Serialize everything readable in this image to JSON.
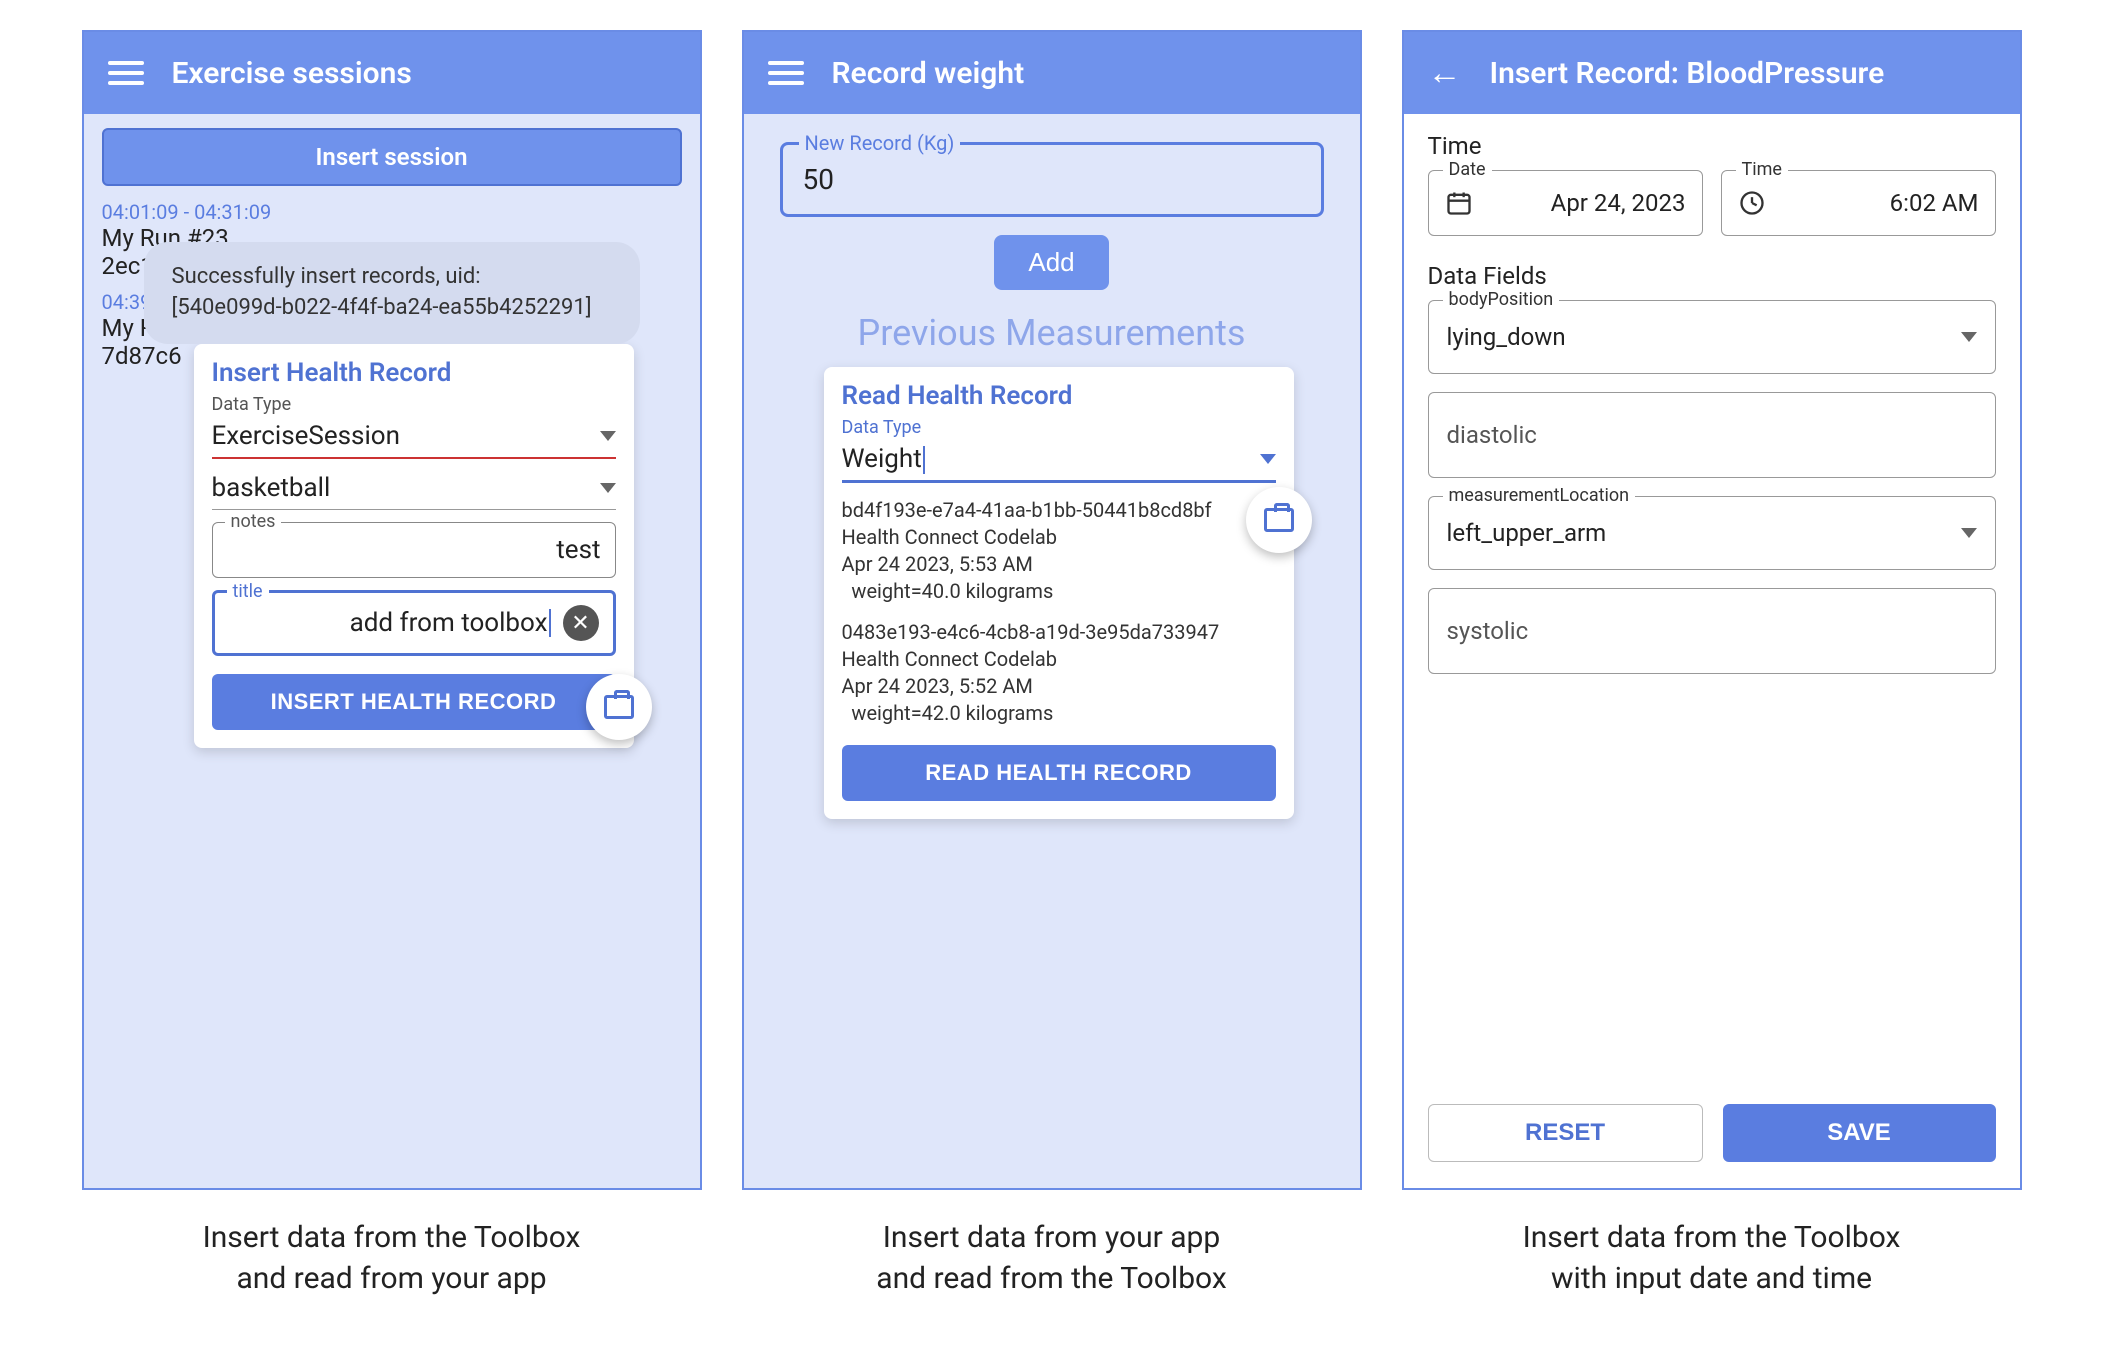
{
  "panel1": {
    "appbar_title": "Exercise sessions",
    "insert_session_btn": "Insert session",
    "runs": [
      {
        "time": "04:01:09 - 04:31:09",
        "title": "My Run #23",
        "uuid": "2ec1eaa2-97f5-4597-b908-18221abf019c"
      },
      {
        "time": "04:39:01 - 05:09:01",
        "title": "My Run #33",
        "uuid": "7d87c6"
      }
    ],
    "popup": {
      "title": "Insert Health Record",
      "data_type_label": "Data Type",
      "data_type_value": "ExerciseSession",
      "exercise_type_value": "basketball",
      "notes_label": "notes",
      "notes_value": "test",
      "title_label": "title",
      "title_value": "add from toolbox",
      "button": "INSERT HEALTH RECORD"
    },
    "snackbar_line1": "Successfully insert records, uid:",
    "snackbar_line2": "[540e099d-b022-4f4f-ba24-ea55b4252291]"
  },
  "panel2": {
    "appbar_title": "Record weight",
    "new_record_label": "New Record (Kg)",
    "new_record_value": "50",
    "add_btn": "Add",
    "previous_title": "Previous Measurements",
    "popup": {
      "title": "Read Health Record",
      "data_type_label": "Data Type",
      "data_type_value": "Weight",
      "readings": [
        {
          "uuid": "bd4f193e-e7a4-41aa-b1bb-50441b8cd8bf",
          "app": "Health Connect Codelab",
          "ts": "Apr 24 2023, 5:53 AM",
          "val": "  weight=40.0 kilograms"
        },
        {
          "uuid": "0483e193-e4c6-4cb8-a19d-3e95da733947",
          "app": "Health Connect Codelab",
          "ts": "Apr 24 2023, 5:52 AM",
          "val": "  weight=42.0 kilograms"
        }
      ],
      "button": "READ HEALTH RECORD"
    }
  },
  "panel3": {
    "appbar_title": "Insert Record: BloodPressure",
    "time_section": "Time",
    "date_label": "Date",
    "date_value": "Apr 24, 2023",
    "time_label": "Time",
    "time_value": "6:02 AM",
    "fields_section": "Data Fields",
    "body_position_label": "bodyPosition",
    "body_position_value": "lying_down",
    "diastolic_label": "diastolic",
    "measurement_location_label": "measurementLocation",
    "measurement_location_value": "left_upper_arm",
    "systolic_label": "systolic",
    "reset_btn": "RESET",
    "save_btn": "SAVE"
  },
  "captions": {
    "c1a": "Insert data from the Toolbox",
    "c1b": "and read from your app",
    "c2a": "Insert data from your app",
    "c2b": "and read from the Toolbox",
    "c3a": "Insert data from the Toolbox",
    "c3b": "with input date and time"
  }
}
